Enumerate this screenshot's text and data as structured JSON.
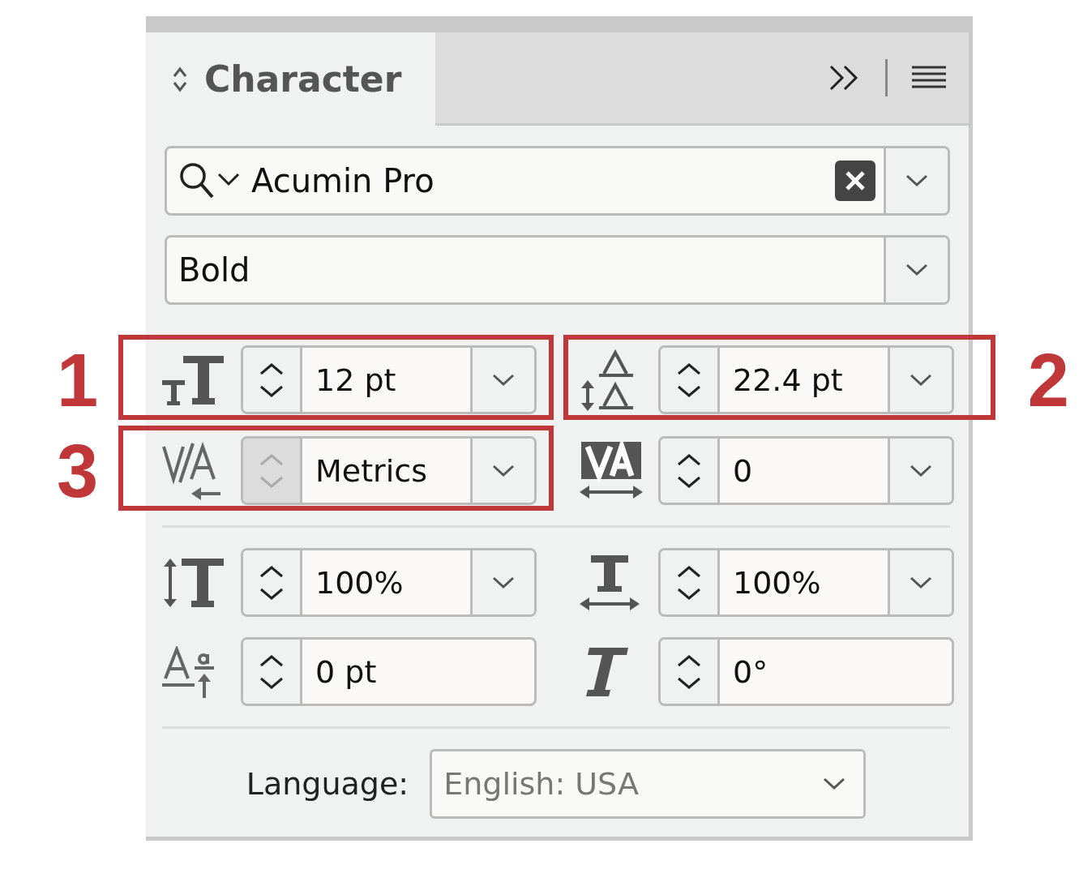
{
  "panel": {
    "tab": {
      "label": "Character"
    }
  },
  "font_family": {
    "value": "Acumin Pro"
  },
  "font_style": {
    "value": "Bold"
  },
  "metric_groups": [
    {
      "fields": [
        {
          "kind": "font-size",
          "value": "12 pt",
          "dropdown": true,
          "arrows_disabled": false,
          "callout": "1"
        },
        {
          "kind": "leading",
          "value": "22.4 pt",
          "dropdown": true,
          "arrows_disabled": false,
          "callout": "2"
        },
        {
          "kind": "kerning",
          "value": "Metrics",
          "dropdown": true,
          "arrows_disabled": true,
          "callout": "3"
        },
        {
          "kind": "tracking",
          "value": "0",
          "dropdown": true,
          "arrows_disabled": false
        }
      ]
    },
    {
      "fields": [
        {
          "kind": "vertical-scale",
          "value": "100%",
          "dropdown": true,
          "arrows_disabled": false
        },
        {
          "kind": "horizontal-scale",
          "value": "100%",
          "dropdown": true,
          "arrows_disabled": false
        },
        {
          "kind": "baseline-shift",
          "value": "0 pt",
          "dropdown": false,
          "arrows_disabled": false
        },
        {
          "kind": "skew",
          "value": "0°",
          "dropdown": false,
          "arrows_disabled": false
        }
      ]
    }
  ],
  "language": {
    "label": "Language:",
    "value": "English: USA"
  }
}
